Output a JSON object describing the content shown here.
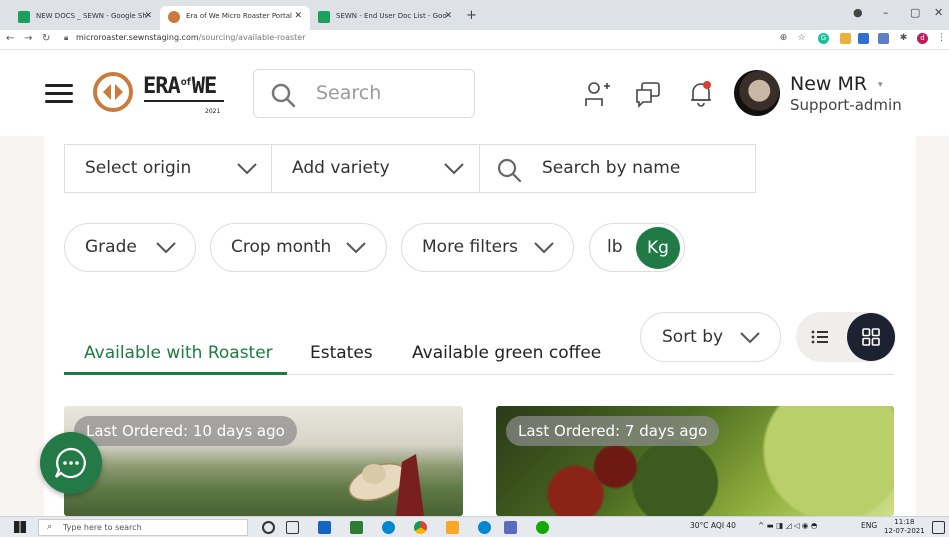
{
  "browser": {
    "tabs": [
      {
        "title": "NEW DOCS _ SEWN - Google Sh",
        "color": "#1a9f5c"
      },
      {
        "title": "Era of We Micro Roaster Portal",
        "color": "#c97a3c"
      },
      {
        "title": "SEWN - End User Doc List - Goo",
        "color": "#1a9f5c"
      }
    ],
    "new_tab": "+",
    "url_host": "microroaster.sewnstaging.com",
    "url_path": "/sourcing/available-roaster",
    "profile_letter": "d"
  },
  "header": {
    "logo_word1": "ERA",
    "logo_sup": "of",
    "logo_word2": "WE",
    "logo_year": "2021",
    "search_placeholder": "Search",
    "user_name": "New MR",
    "user_role": "Support-admin",
    "caret": "▾"
  },
  "filters": {
    "origin": "Select origin",
    "variety": "Add variety",
    "search_name_placeholder": "Search by name",
    "grade": "Grade",
    "crop_month": "Crop month",
    "more_filters": "More filters",
    "unit_lb": "lb",
    "unit_kg": "Kg"
  },
  "tabs": [
    {
      "label": "Available with Roaster",
      "active": true
    },
    {
      "label": "Estates",
      "active": false
    },
    {
      "label": "Available green coffee",
      "active": false
    }
  ],
  "sort": {
    "label": "Sort by"
  },
  "cards": [
    {
      "badge": "Last Ordered: 10 days ago"
    },
    {
      "badge": "Last Ordered: 7 days ago"
    }
  ],
  "colors": {
    "accent": "#1f7a46",
    "dark": "#1c2230"
  },
  "taskbar": {
    "search_placeholder": "Type here to search",
    "weather": "30°C  AQI 40",
    "lang": "ENG",
    "time": "11:18",
    "date": "12-07-2021"
  }
}
